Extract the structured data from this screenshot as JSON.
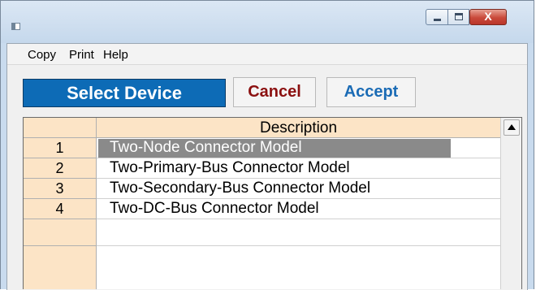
{
  "menu": {
    "items": [
      "Copy",
      "Print",
      "Help"
    ]
  },
  "window_controls": {
    "close_glyph": "X"
  },
  "toolbar": {
    "select_device_label": "Select Device",
    "cancel_label": "Cancel",
    "accept_label": "Accept"
  },
  "table": {
    "header": {
      "description": "Description"
    },
    "rows": [
      {
        "num": "1",
        "description": "Two-Node Connector Model",
        "selected": true
      },
      {
        "num": "2",
        "description": "Two-Primary-Bus Connector Model"
      },
      {
        "num": "3",
        "description": "Two-Secondary-Bus Connector Model"
      },
      {
        "num": "4",
        "description": "Two-DC-Bus Connector Model"
      },
      {
        "num": "",
        "description": ""
      },
      {
        "num": "",
        "description": ""
      }
    ]
  },
  "colors": {
    "select_banner_bg": "#0d6bb6",
    "cancel_text": "#8b1010",
    "accept_text": "#1a6bb5",
    "row_header_bg": "#fce4c6",
    "selection_bg": "#8a8a8a"
  },
  "icons": {
    "app": "app-window-icon",
    "minimize": "minimize-icon",
    "maximize": "maximize-icon",
    "close": "close-icon",
    "scroll_up": "triangle-up-icon"
  }
}
